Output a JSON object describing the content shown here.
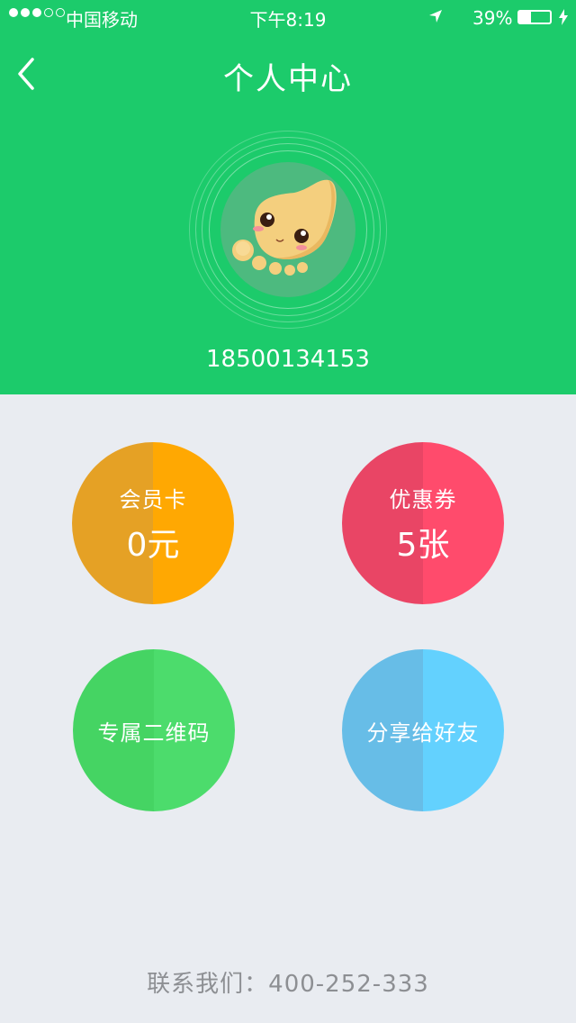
{
  "status_bar": {
    "signal_dots": [
      true,
      true,
      true,
      false,
      false
    ],
    "carrier": "中国移动",
    "time": "下午8:19",
    "battery_percent": "39%",
    "battery_level": 0.39
  },
  "nav": {
    "back_icon": "chevron-left-icon",
    "title": "个人中心"
  },
  "profile": {
    "avatar_icon": "bean-mascot-avatar",
    "phone": "18500134153"
  },
  "tiles": [
    {
      "label": "会员卡",
      "value": "0元",
      "color_left": "#E5A125",
      "color_right": "#FFA802"
    },
    {
      "label": "优惠券",
      "value": "5张",
      "color_left": "#E94565",
      "color_right": "#FF4B6C"
    },
    {
      "label": "专属二维码",
      "value": "",
      "color_left": "#45D463",
      "color_right": "#4CDC6C"
    },
    {
      "label": "分享给好友",
      "value": "",
      "color_left": "#67BDE7",
      "color_right": "#63D1FE"
    }
  ],
  "footer": {
    "contact": "联系我们：400-252-333"
  },
  "colors": {
    "header_bg": "#1CCB6B",
    "page_bg": "#E9ECF1"
  }
}
